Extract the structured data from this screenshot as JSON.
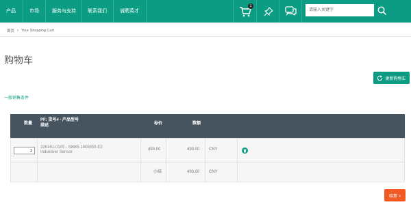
{
  "nav": {
    "items": [
      "产品",
      "市场",
      "服务与支持",
      "联系我们",
      "诚聘英才"
    ],
    "cart_count": "1",
    "search_placeholder": "请输入关键字"
  },
  "breadcrumb": {
    "home": "首页",
    "current": "Your Shopping Cart"
  },
  "page": {
    "title": "购物车",
    "update_button": "更新购物车",
    "terms_link": "一般销售条件",
    "checkout_button": "结算 >"
  },
  "table": {
    "headers": {
      "qty": "数量",
      "product_line1": "PF: 货号# - 产品型号",
      "product_line2": "描述",
      "list_price": "标价",
      "amount": "数额"
    },
    "rows": [
      {
        "qty": "1",
        "product": "326161-0105 - NBB5-18GM50-E2",
        "description": "Induktiver Sensor",
        "list_price": "493.00",
        "amount": "493.00",
        "currency": "CNY"
      }
    ],
    "subtotal": {
      "label": "小结",
      "amount": "493.00",
      "currency": "CNY"
    }
  },
  "colors": {
    "brand": "#0c9b83",
    "header_bg": "#45545f",
    "checkout": "#f15a24"
  },
  "icons": [
    "cart-icon",
    "pin-icon",
    "chat-icon",
    "search-icon",
    "refresh-icon",
    "trash-icon"
  ]
}
